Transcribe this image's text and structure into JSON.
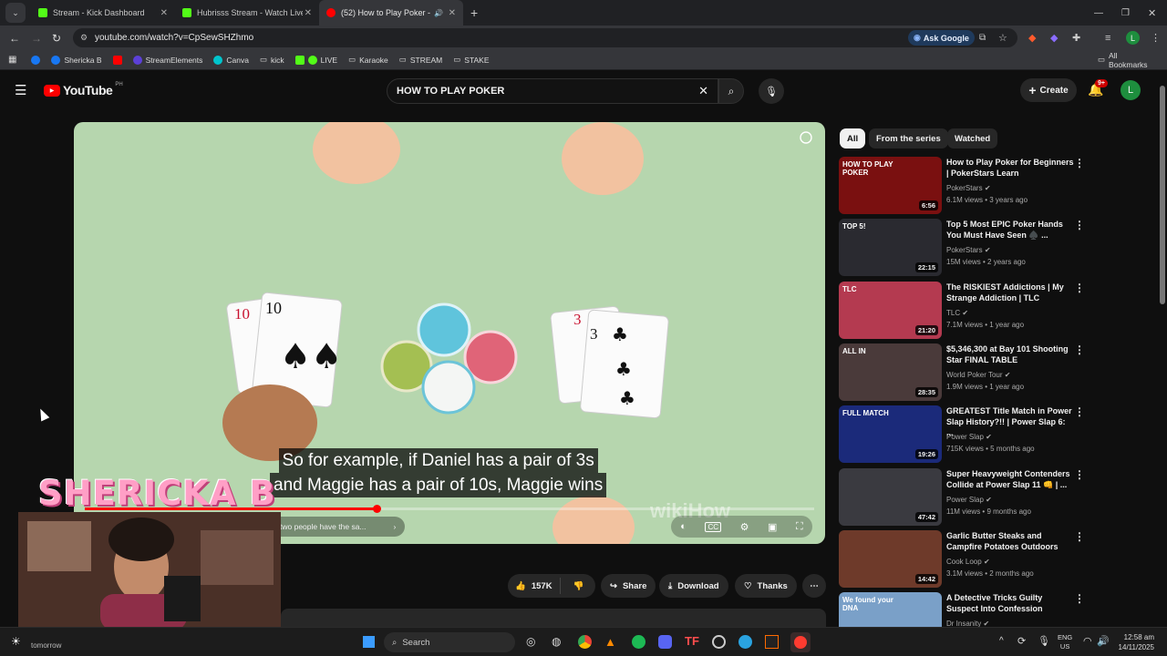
{
  "browser": {
    "tabs": [
      {
        "title": "Stream - Kick Dashboard",
        "color": "#53fc18"
      },
      {
        "title": "Hubrisss Stream - Watch Live o",
        "color": "#53fc18"
      },
      {
        "title": "(52) How to Play Poker - Yo",
        "color": "#ff0000"
      }
    ],
    "url": "youtube.com/watch?v=CpSewSHZhmo",
    "ask_google": "Ask Google",
    "avatar_letter": "L",
    "bookmarks": [
      "Shericka B",
      "StreamElements",
      "Canva",
      "kick",
      "LIVE",
      "Karaoke",
      "STREAM",
      "STAKE"
    ],
    "all_bookmarks": "All Bookmarks"
  },
  "youtube": {
    "logo": "YouTube",
    "logo_region": "PH",
    "search_value": "HOW TO PLAY POKER",
    "create_label": "Create",
    "notif_badge": "9+",
    "avatar_letter": "L",
    "chips": [
      "All",
      "From the series",
      "Watched"
    ],
    "player": {
      "subtitle_line1": "So for example, if Daniel has a pair of 3s",
      "subtitle_line2": "and Maggie has a pair of 10s, Maggie wins",
      "chapter": "two people have the sa...",
      "watermark": "wikiHow",
      "progress": 0.4
    },
    "actions": {
      "likes": "157K",
      "share": "Share",
      "download": "Download",
      "thanks": "Thanks"
    },
    "recommendations": [
      {
        "title": "How to Play Poker for Beginners | PokerStars Learn",
        "channel": "PokerStars",
        "meta": "6.1M views • 3 years ago",
        "duration": "6:56",
        "thumb_text": "HOW TO PLAY POKER"
      },
      {
        "title": "Top 5 Most EPIC Poker Hands You Must Have Seen ♠️ ...",
        "channel": "PokerStars",
        "meta": "15M views • 2 years ago",
        "duration": "22:15",
        "thumb_text": "TOP 5!"
      },
      {
        "title": "The RISKIEST Addictions | My Strange Addiction | TLC",
        "channel": "TLC",
        "meta": "7.1M views • 1 year ago",
        "duration": "21:20",
        "thumb_text": "TLC"
      },
      {
        "title": "$5,346,300 at Bay 101 Shooting Star FINAL TABLE",
        "channel": "World Poker Tour",
        "meta": "1.9M views • 1 year ago",
        "duration": "28:35",
        "thumb_text": "ALL IN"
      },
      {
        "title": "GREATEST Title Match in Power Slap History?!! | Power Slap 6: ...",
        "channel": "Power Slap",
        "meta": "715K views • 5 months ago",
        "duration": "19:26",
        "thumb_text": "FULL MATCH"
      },
      {
        "title": "Super Heavyweight Contenders Collide at Power Slap 11 👊 | ...",
        "channel": "Power Slap",
        "meta": "11M views • 9 months ago",
        "duration": "47:42",
        "thumb_text": ""
      },
      {
        "title": "Garlic Butter Steaks and Campfire Potatoes Outdoors",
        "channel": "Cook Loop",
        "meta": "3.1M views • 2 months ago",
        "duration": "14:42",
        "thumb_text": ""
      },
      {
        "title": "A Detective Tricks Guilty Suspect Into Confession",
        "channel": "Dr Insanity",
        "meta": "",
        "duration": "",
        "thumb_text": "We found your DNA"
      }
    ]
  },
  "overlay": {
    "name": "SHERICKA B",
    "tomorrow": "tomorrow"
  },
  "taskbar": {
    "search": "Search",
    "lang1": "ENG",
    "lang2": "US",
    "time": "12:58 am",
    "date": "14/11/2025"
  }
}
